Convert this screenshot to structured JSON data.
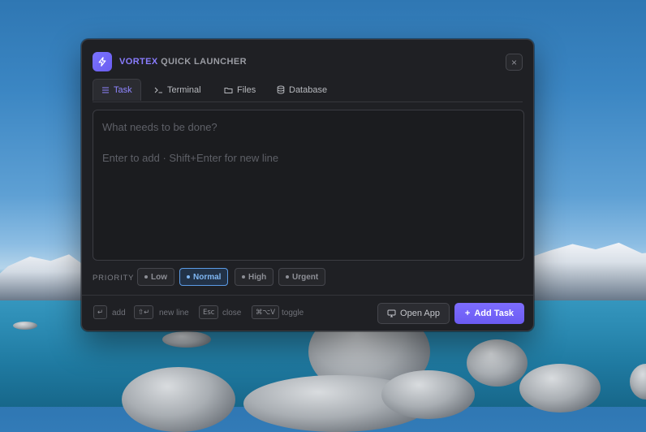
{
  "header": {
    "brand": "VORTEX",
    "title_rest": "QUICK LAUNCHER",
    "close_glyph": "×",
    "logo_icon": "lightning-bolt-icon"
  },
  "tabs": [
    {
      "label": "Task",
      "icon": "list-icon",
      "active": true
    },
    {
      "label": "Terminal",
      "icon": "terminal-prompt-icon",
      "active": false
    },
    {
      "label": "Files",
      "icon": "folder-icon",
      "active": false
    },
    {
      "label": "Database",
      "icon": "database-icon",
      "active": false
    }
  ],
  "task_input": {
    "placeholder": "What needs to be done?",
    "hint": "Enter to add · Shift+Enter for new line"
  },
  "priority": {
    "label": "PRIORITY",
    "options": [
      "Low",
      "Normal",
      "High",
      "Urgent"
    ],
    "selected": "Normal"
  },
  "shortcuts": [
    {
      "key": "↵",
      "label": "add"
    },
    {
      "key": "⇧↵",
      "label": "new line"
    },
    {
      "key": "Esc",
      "label": "close"
    },
    {
      "key": "⌘⌥V",
      "label": "toggle"
    }
  ],
  "actions": {
    "open_app": "Open App",
    "add_task": "Add Task",
    "add_prefix": "+"
  },
  "colors": {
    "accent": "#7d6dff",
    "selected_priority": "#5b9be6",
    "window_bg": "#1f2024"
  }
}
